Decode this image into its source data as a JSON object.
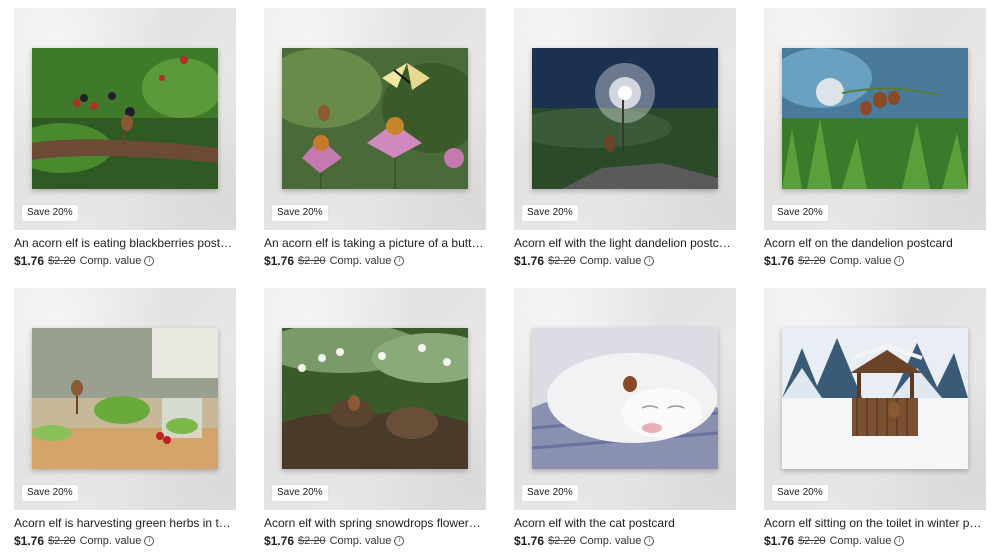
{
  "products": [
    {
      "title": "An acorn elf is eating blackberries postcard",
      "badge": "Save 20%",
      "price": "$1.76",
      "original_price": "$2.20",
      "comp_label": "Comp. value",
      "scene": "blackberries"
    },
    {
      "title": "An acorn elf is taking a picture of a butterfly postcard",
      "badge": "Save 20%",
      "price": "$1.76",
      "original_price": "$2.20",
      "comp_label": "Comp. value",
      "scene": "butterfly"
    },
    {
      "title": "Acorn elf with the light dandelion postcard",
      "badge": "Save 20%",
      "price": "$1.76",
      "original_price": "$2.20",
      "comp_label": "Comp. value",
      "scene": "light-dandelion"
    },
    {
      "title": "Acorn elf on the dandelion postcard",
      "badge": "Save 20%",
      "price": "$1.76",
      "original_price": "$2.20",
      "comp_label": "Comp. value",
      "scene": "dandelion"
    },
    {
      "title": "Acorn elf is harvesting green herbs in the kitchen postcard",
      "badge": "Save 20%",
      "price": "$1.76",
      "original_price": "$2.20",
      "comp_label": "Comp. value",
      "scene": "herbs"
    },
    {
      "title": "Acorn elf with spring snowdrops flowers postcard",
      "badge": "Save 20%",
      "price": "$1.76",
      "original_price": "$2.20",
      "comp_label": "Comp. value",
      "scene": "snowdrops"
    },
    {
      "title": "Acorn elf with the cat postcard",
      "badge": "Save 20%",
      "price": "$1.76",
      "original_price": "$2.20",
      "comp_label": "Comp. value",
      "scene": "cat"
    },
    {
      "title": "Acorn elf sitting on the toilet in winter postcard",
      "badge": "Save 20%",
      "price": "$1.76",
      "original_price": "$2.20",
      "comp_label": "Comp. value",
      "scene": "winter-toilet"
    }
  ],
  "icons": {
    "info": "info-circle-icon"
  }
}
